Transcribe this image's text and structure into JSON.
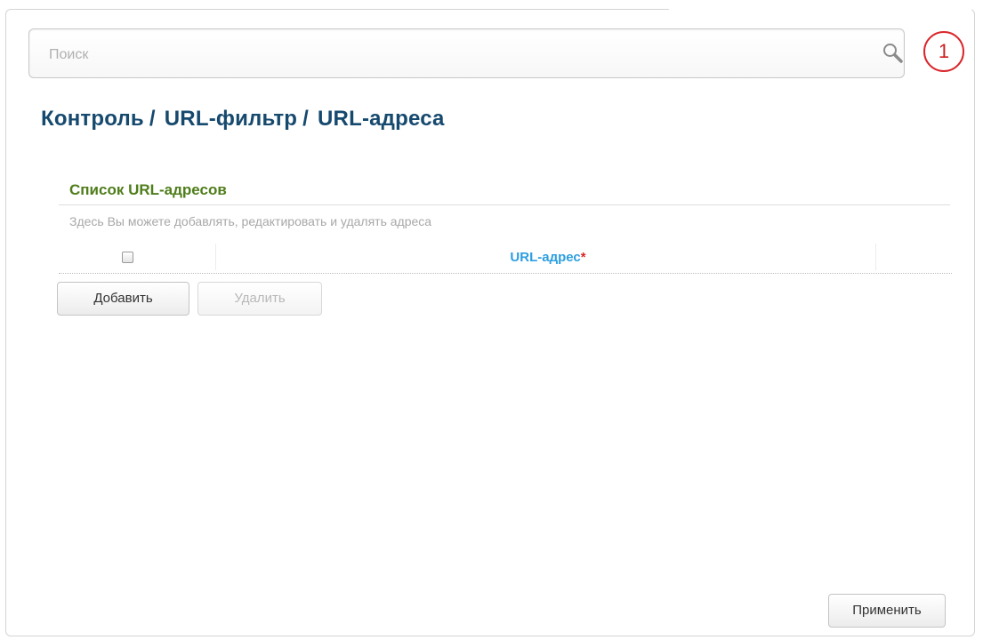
{
  "search": {
    "placeholder": "Поиск"
  },
  "notifications": {
    "count": "1"
  },
  "breadcrumb": [
    "Контроль",
    "URL-фильтр",
    "URL-адреса"
  ],
  "section": {
    "title": "Список URL-адресов",
    "description": "Здесь Вы можете добавлять, редактировать и удалять адреса"
  },
  "table": {
    "columns": [
      {
        "label": "URL-адрес",
        "required_mark": "*"
      }
    ],
    "rows": []
  },
  "buttons": {
    "add": "Добавить",
    "delete": "Удалить",
    "apply": "Применить"
  },
  "colors": {
    "breadcrumb": "#16496e",
    "section_title": "#4e7d1a",
    "column_header": "#2c9ee0",
    "required": "#d9262b",
    "notification_ring": "#d9262b"
  }
}
